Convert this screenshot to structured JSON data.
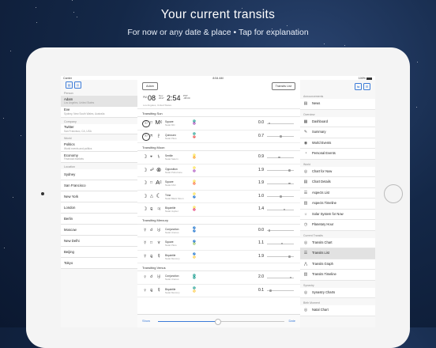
{
  "promo": {
    "headline": "Your current transits",
    "subline": "For now or any date & place  •  Tap for explanation"
  },
  "status_bar": {
    "carrier": "Carrier",
    "time": "8:54 AM",
    "battery": "100%"
  },
  "left_panel": {
    "person_section": "Person",
    "people": [
      {
        "name": "Adam",
        "detail": "Los Angeles, United States",
        "selected": true
      },
      {
        "name": "Eve",
        "detail": "Sydney, New South Wales, Australia",
        "selected": false
      }
    ],
    "company_section": "Company",
    "companies": [
      {
        "name": "Twitter",
        "detail": "San Francisco, CA, USA"
      }
    ],
    "world_section": "World",
    "worlds": [
      {
        "name": "Politics",
        "detail": "World events and politics"
      },
      {
        "name": "Economy",
        "detail": "Financial markets"
      }
    ],
    "location_section": "Location",
    "locations": [
      "Sydney",
      "San Francisco",
      "New York",
      "London",
      "Berlin",
      "Moscow",
      "New Delhi",
      "Beijing",
      "Tokyo"
    ]
  },
  "middle_panel": {
    "person_button": "Adam",
    "list_button": "Transits List",
    "date": {
      "ampm": "PM",
      "day": "08",
      "month": "Nov",
      "year": "2017",
      "time": "2:54",
      "zone": "PST",
      "offset": "-08:00",
      "place": "Los Angeles, United States"
    },
    "groups": [
      {
        "title": "Transiting Sun",
        "rows": [
          {
            "g1": "☉",
            "ring": true,
            "asp": "□",
            "g2": "Mᶜ",
            "line1": "Square",
            "line2": "Natal MC",
            "s1": "♏",
            "s2": "♒",
            "value": "0.0",
            "marker": 0.05
          },
          {
            "g1": "☉",
            "ring": true,
            "asp": "⚻",
            "g2": "♇",
            "line1": "Quincunx",
            "line2": "Natal Pluto",
            "s1": "♏",
            "s2": "♈",
            "value": "0.7",
            "marker": 0.5
          }
        ]
      },
      {
        "title": "Transiting Moon",
        "rows": [
          {
            "g1": "☽",
            "ring": false,
            "asp": "⚹",
            "g2": "♄",
            "line1": "Sextile",
            "line2": "Natal Saturn",
            "s1": "♌",
            "s2": "♊",
            "value": "0.9",
            "marker": 0.45
          },
          {
            "g1": "☽",
            "ring": false,
            "asp": "☍",
            "g2": "⊗",
            "line1": "Opposition",
            "line2": "Natal PoFortune",
            "s1": "♌",
            "s2": "♒",
            "value": "1.9",
            "marker": 0.85
          },
          {
            "g1": "☽",
            "ring": false,
            "asp": "□",
            "g2": "Aᶜ",
            "line1": "Square",
            "line2": "Natal ASC",
            "s1": "♌",
            "s2": "♉",
            "value": "1.9",
            "marker": 0.85
          },
          {
            "g1": "☽",
            "ring": false,
            "asp": "△",
            "g2": "☾",
            "line1": "Trine",
            "line2": "Natal Black Moon",
            "s1": "♌",
            "s2": "♐",
            "value": "1.0",
            "marker": 0.5
          },
          {
            "g1": "☽",
            "ring": false,
            "asp": "⚼",
            "g2": "♃",
            "line1": "Biquintile",
            "line2": "Natal Jupiter",
            "s1": "♌",
            "s2": "♓",
            "value": "1.4",
            "marker": 0.65
          }
        ]
      },
      {
        "title": "Transiting Mercury",
        "rows": [
          {
            "g1": "☿",
            "ring": false,
            "asp": "☌",
            "g2": "♅",
            "line1": "Conjunction",
            "line2": "Natal Uranus",
            "s1": "♐",
            "s2": "♐",
            "value": "0.0",
            "marker": 0.05
          },
          {
            "g1": "☿",
            "ring": false,
            "asp": "□",
            "g2": "♆",
            "line1": "Square",
            "line2": "Natal Pluto",
            "s1": "♐",
            "s2": "♍",
            "value": "1.1",
            "marker": 0.55
          },
          {
            "g1": "☿",
            "ring": false,
            "asp": "⚼",
            "g2": "☿",
            "line1": "Biquintile",
            "line2": "Natal Mercury",
            "s1": "♐",
            "s2": "♋",
            "value": "1.9",
            "marker": 0.85
          }
        ]
      },
      {
        "title": "Transiting Venus",
        "rows": [
          {
            "g1": "♀",
            "ring": false,
            "asp": "☌",
            "g2": "♅",
            "line1": "Conjunction",
            "line2": "Natal Uranus",
            "s1": "♏",
            "s2": "♏",
            "value": "2.0",
            "marker": 0.9
          },
          {
            "g1": "♀",
            "ring": false,
            "asp": "⚼",
            "g2": "☿",
            "line1": "Biquintile",
            "line2": "Natal Mercury",
            "s1": "♏",
            "s2": "♋",
            "value": "0.1",
            "marker": 0.1
          }
        ]
      }
    ],
    "slider": {
      "left_label": "Show",
      "right_label": "Date",
      "position": 0.47
    }
  },
  "right_panel": {
    "sections": [
      {
        "title": "Announcements",
        "items": [
          {
            "label": "News",
            "icon": "news-icon",
            "glyph": "▤"
          }
        ]
      },
      {
        "title": "Overview",
        "items": [
          {
            "label": "Dashboard",
            "icon": "dashboard-icon",
            "glyph": "▦"
          },
          {
            "label": "Summary",
            "icon": "summary-icon",
            "glyph": "✎"
          },
          {
            "label": "World Events",
            "icon": "world-icon",
            "glyph": "◉"
          },
          {
            "label": "Personal Events",
            "icon": "person-icon",
            "glyph": "◔"
          }
        ]
      },
      {
        "title": "World",
        "items": [
          {
            "label": "Chart for Now",
            "icon": "wheel-icon",
            "glyph": "◎"
          },
          {
            "label": "Chart Details",
            "icon": "details-icon",
            "glyph": "▤"
          },
          {
            "label": "Aspects List",
            "icon": "list-icon",
            "glyph": "☰"
          },
          {
            "label": "Aspects Timeline",
            "icon": "timeline-icon",
            "glyph": "▥"
          },
          {
            "label": "Solar System for Now",
            "icon": "solar-icon",
            "glyph": "☼"
          },
          {
            "label": "Planetary Hour",
            "icon": "hour-icon",
            "glyph": "◷"
          }
        ]
      },
      {
        "title": "Current Transits",
        "items": [
          {
            "label": "Transits Chart",
            "icon": "wheel-icon",
            "glyph": "◎"
          },
          {
            "label": "Transits List",
            "icon": "list-icon",
            "glyph": "☰",
            "selected": true
          },
          {
            "label": "Transits Graph",
            "icon": "graph-icon",
            "glyph": "⋀"
          },
          {
            "label": "Transits Timeline",
            "icon": "timeline-icon",
            "glyph": "▥"
          }
        ]
      },
      {
        "title": "Synastry",
        "items": [
          {
            "label": "Synastry Charts",
            "icon": "synastry-icon",
            "glyph": "◎"
          }
        ]
      },
      {
        "title": "Birth Moment",
        "items": [
          {
            "label": "Natal Chart",
            "icon": "natal-icon",
            "glyph": "◎"
          }
        ]
      }
    ]
  },
  "colors": {
    "accent": "#3b7bd8",
    "background": "#142848"
  }
}
